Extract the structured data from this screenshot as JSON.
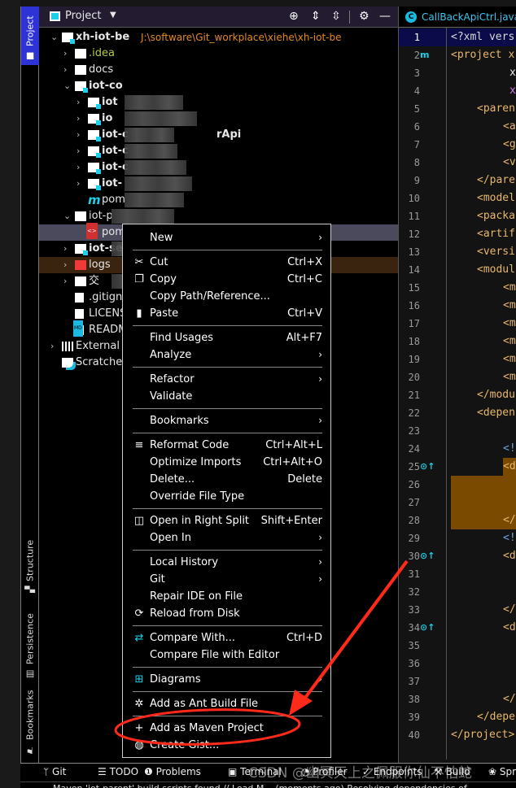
{
  "tool_stripe": {
    "project": "Project",
    "structure": "Structure",
    "persistence": "Persistence",
    "bookmarks": "Bookmarks"
  },
  "project_panel": {
    "title": "Project",
    "root": {
      "name": "xh-iot-be",
      "path": "J:\\software\\Git_workplace\\xiehe\\xh-iot-be"
    },
    "rows": [
      {
        "label": ".idea",
        "color": "#b5c949"
      },
      {
        "label": "docs"
      },
      {
        "label": "iot-co"
      },
      {
        "label": "iot"
      },
      {
        "label": "io"
      },
      {
        "label": "iot-c",
        "suffix": "rApi"
      },
      {
        "label": "iot-c"
      },
      {
        "label": "iot-c"
      },
      {
        "label": "iot-"
      },
      {
        "label": "pom"
      },
      {
        "label": "iot-p"
      },
      {
        "label": "pom"
      },
      {
        "label": "iot-serv"
      },
      {
        "label": "logs"
      },
      {
        "label": "交"
      },
      {
        "label": ".gitignc"
      },
      {
        "label": "LICENS"
      },
      {
        "label": "READM"
      },
      {
        "label": "External Li"
      },
      {
        "label": "Scratches"
      }
    ]
  },
  "editor": {
    "tab": "CallBackApiCtrl.java",
    "lines": [
      "<?xml vers",
      "<project x",
      "x",
      "x",
      "<paren",
      "<a",
      "<g",
      "<v",
      "</pare",
      "<model",
      "<packa",
      "<artif",
      "<versi",
      "<modul",
      "<m",
      "<m",
      "<m",
      "<m",
      "<m",
      "<m",
      "</modul",
      "<depen",
      "",
      "<!",
      "<d",
      "",
      "",
      "</",
      "<!",
      "<d",
      "",
      "",
      "</",
      "<d",
      "",
      "",
      "",
      "</",
      "</depe",
      "</project>"
    ]
  },
  "context_menu": {
    "items": [
      {
        "label": "New",
        "arrow": true
      },
      {
        "sep": true
      },
      {
        "label": "Cut",
        "shortcut": "Ctrl+X",
        "icon": "scissors-icon"
      },
      {
        "label": "Copy",
        "shortcut": "Ctrl+C",
        "icon": "copy-icon"
      },
      {
        "label": "Copy Path/Reference..."
      },
      {
        "label": "Paste",
        "shortcut": "Ctrl+V",
        "icon": "clipboard-icon"
      },
      {
        "sep": true
      },
      {
        "label": "Find Usages",
        "shortcut": "Alt+F7"
      },
      {
        "label": "Analyze",
        "arrow": true
      },
      {
        "sep": true
      },
      {
        "label": "Refactor",
        "arrow": true
      },
      {
        "label": "Validate"
      },
      {
        "sep": true
      },
      {
        "label": "Bookmarks",
        "arrow": true
      },
      {
        "sep": true
      },
      {
        "label": "Reformat Code",
        "shortcut": "Ctrl+Alt+L",
        "icon": "reformat-icon"
      },
      {
        "label": "Optimize Imports",
        "shortcut": "Ctrl+Alt+O"
      },
      {
        "label": "Delete...",
        "shortcut": "Delete"
      },
      {
        "label": "Override File Type"
      },
      {
        "sep": true
      },
      {
        "label": "Open in Right Split",
        "shortcut": "Shift+Enter",
        "icon": "split-icon"
      },
      {
        "label": "Open In",
        "arrow": true
      },
      {
        "sep": true
      },
      {
        "label": "Local History",
        "arrow": true
      },
      {
        "label": "Git",
        "arrow": true
      },
      {
        "label": "Repair IDE on File"
      },
      {
        "label": "Reload from Disk",
        "icon": "reload-icon"
      },
      {
        "sep": true
      },
      {
        "label": "Compare With...",
        "shortcut": "Ctrl+D",
        "icon": "compare-icon"
      },
      {
        "label": "Compare File with Editor"
      },
      {
        "sep": true
      },
      {
        "label": "Diagrams",
        "arrow": true,
        "icon": "diagram-icon"
      },
      {
        "sep": true
      },
      {
        "label": "Add as Ant Build File",
        "icon": "ant-icon"
      },
      {
        "sep": true
      },
      {
        "label": "Add as Maven Project",
        "icon": "plus-icon"
      },
      {
        "label": "Create Gist...",
        "icon": "github-icon"
      }
    ]
  },
  "bottom_bar": [
    "Git",
    "TODO",
    "Problems",
    "Terminal",
    "Profiler",
    "Endpoints",
    "Build",
    "Spring"
  ],
  "status": "Maven 'iot-parent' build scripts found // Load M... (moments ago)     Resolving dependencies of",
  "watermark": "CSDN @幽冥天上之佩服你仙不怕蛇",
  "colors": {
    "accent": "#2e33d6",
    "annotation": "#ff2a1a",
    "highlight": "#7a4a00"
  }
}
